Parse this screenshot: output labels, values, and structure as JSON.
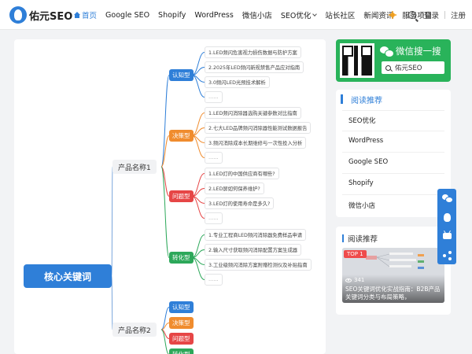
{
  "header": {
    "logo_text": "佑元SEO",
    "nav": [
      {
        "label": "首页",
        "active": true
      },
      {
        "label": "Google SEO"
      },
      {
        "label": "Shopify"
      },
      {
        "label": "WordPress"
      },
      {
        "label": "微信小店"
      },
      {
        "label": "SEO优化",
        "dropdown": true
      },
      {
        "label": "站长社区"
      },
      {
        "label": "新闻资讯"
      },
      {
        "label": "服务项目"
      }
    ],
    "login": "登录",
    "register": "注册"
  },
  "mindmap": {
    "root": "核心关键词",
    "branches": [
      {
        "label": "产品名称1",
        "groups": [
          {
            "tag": "认知型",
            "color": "#2f7fd8",
            "leaves": [
              "1.LED频闪危害视力损伤数据与防护方案",
              "2.2025年LED频闪新规禁售产品应对指南",
              "3.0频闪LED光预技术解析",
              "……"
            ]
          },
          {
            "tag": "决策型",
            "color": "#f08c2e",
            "leaves": [
              "1.LED频闪消除器选购关键参数对比指南",
              "2.七大LED品牌频闪消除器性能测试数据报告",
              "3.频闪消除成本长期维修与一次性投入分析",
              "……"
            ]
          },
          {
            "tag": "问题型",
            "color": "#e64646",
            "leaves": [
              "1.LED灯的中国供应商有哪些?",
              "2.LED屏如何保养维护?",
              "3.LED灯的使用寿命是多久?",
              "……"
            ]
          },
          {
            "tag": "转化型",
            "color": "#2da85a",
            "leaves": [
              "1.专业工程商LED频闪消除器免费样品申请",
              "2.输入尺寸获取频闪消除配置方案生成器",
              "3.工业级频闪消除方案附赠检测仪及补贴指南",
              "……"
            ]
          }
        ]
      },
      {
        "label": "产品名称2",
        "groups": [
          {
            "tag": "认知型",
            "color": "#2f7fd8"
          },
          {
            "tag": "决策型",
            "color": "#f08c2e"
          },
          {
            "tag": "问题型",
            "color": "#e64646"
          },
          {
            "tag": "转化型",
            "color": "#2da85a"
          }
        ]
      }
    ]
  },
  "wechat": {
    "title": "微信搜一搜",
    "search_value": "佑元SEO"
  },
  "reading": {
    "title": "阅读推荐",
    "items": [
      "SEO优化",
      "WordPress",
      "Google SEO",
      "Shopify",
      "微信小店"
    ]
  },
  "reading2": {
    "title": "阅读推荐",
    "badge": "TOP 1",
    "views": "341",
    "article_title": "SEO关键词优化实战指南：B2B产品关键词分类与布局策略，"
  },
  "icons": {
    "theme": "sun-icon",
    "search": "search-icon",
    "float_bar": [
      "wechat-icon",
      "qq-icon",
      "bilibili-icon",
      "share-icon"
    ]
  },
  "colors": {
    "primary": "#2f7fd8",
    "wechat_green": "#29b35a",
    "tag_orange": "#f08c2e",
    "tag_red": "#e64646",
    "tag_green": "#2da85a"
  }
}
